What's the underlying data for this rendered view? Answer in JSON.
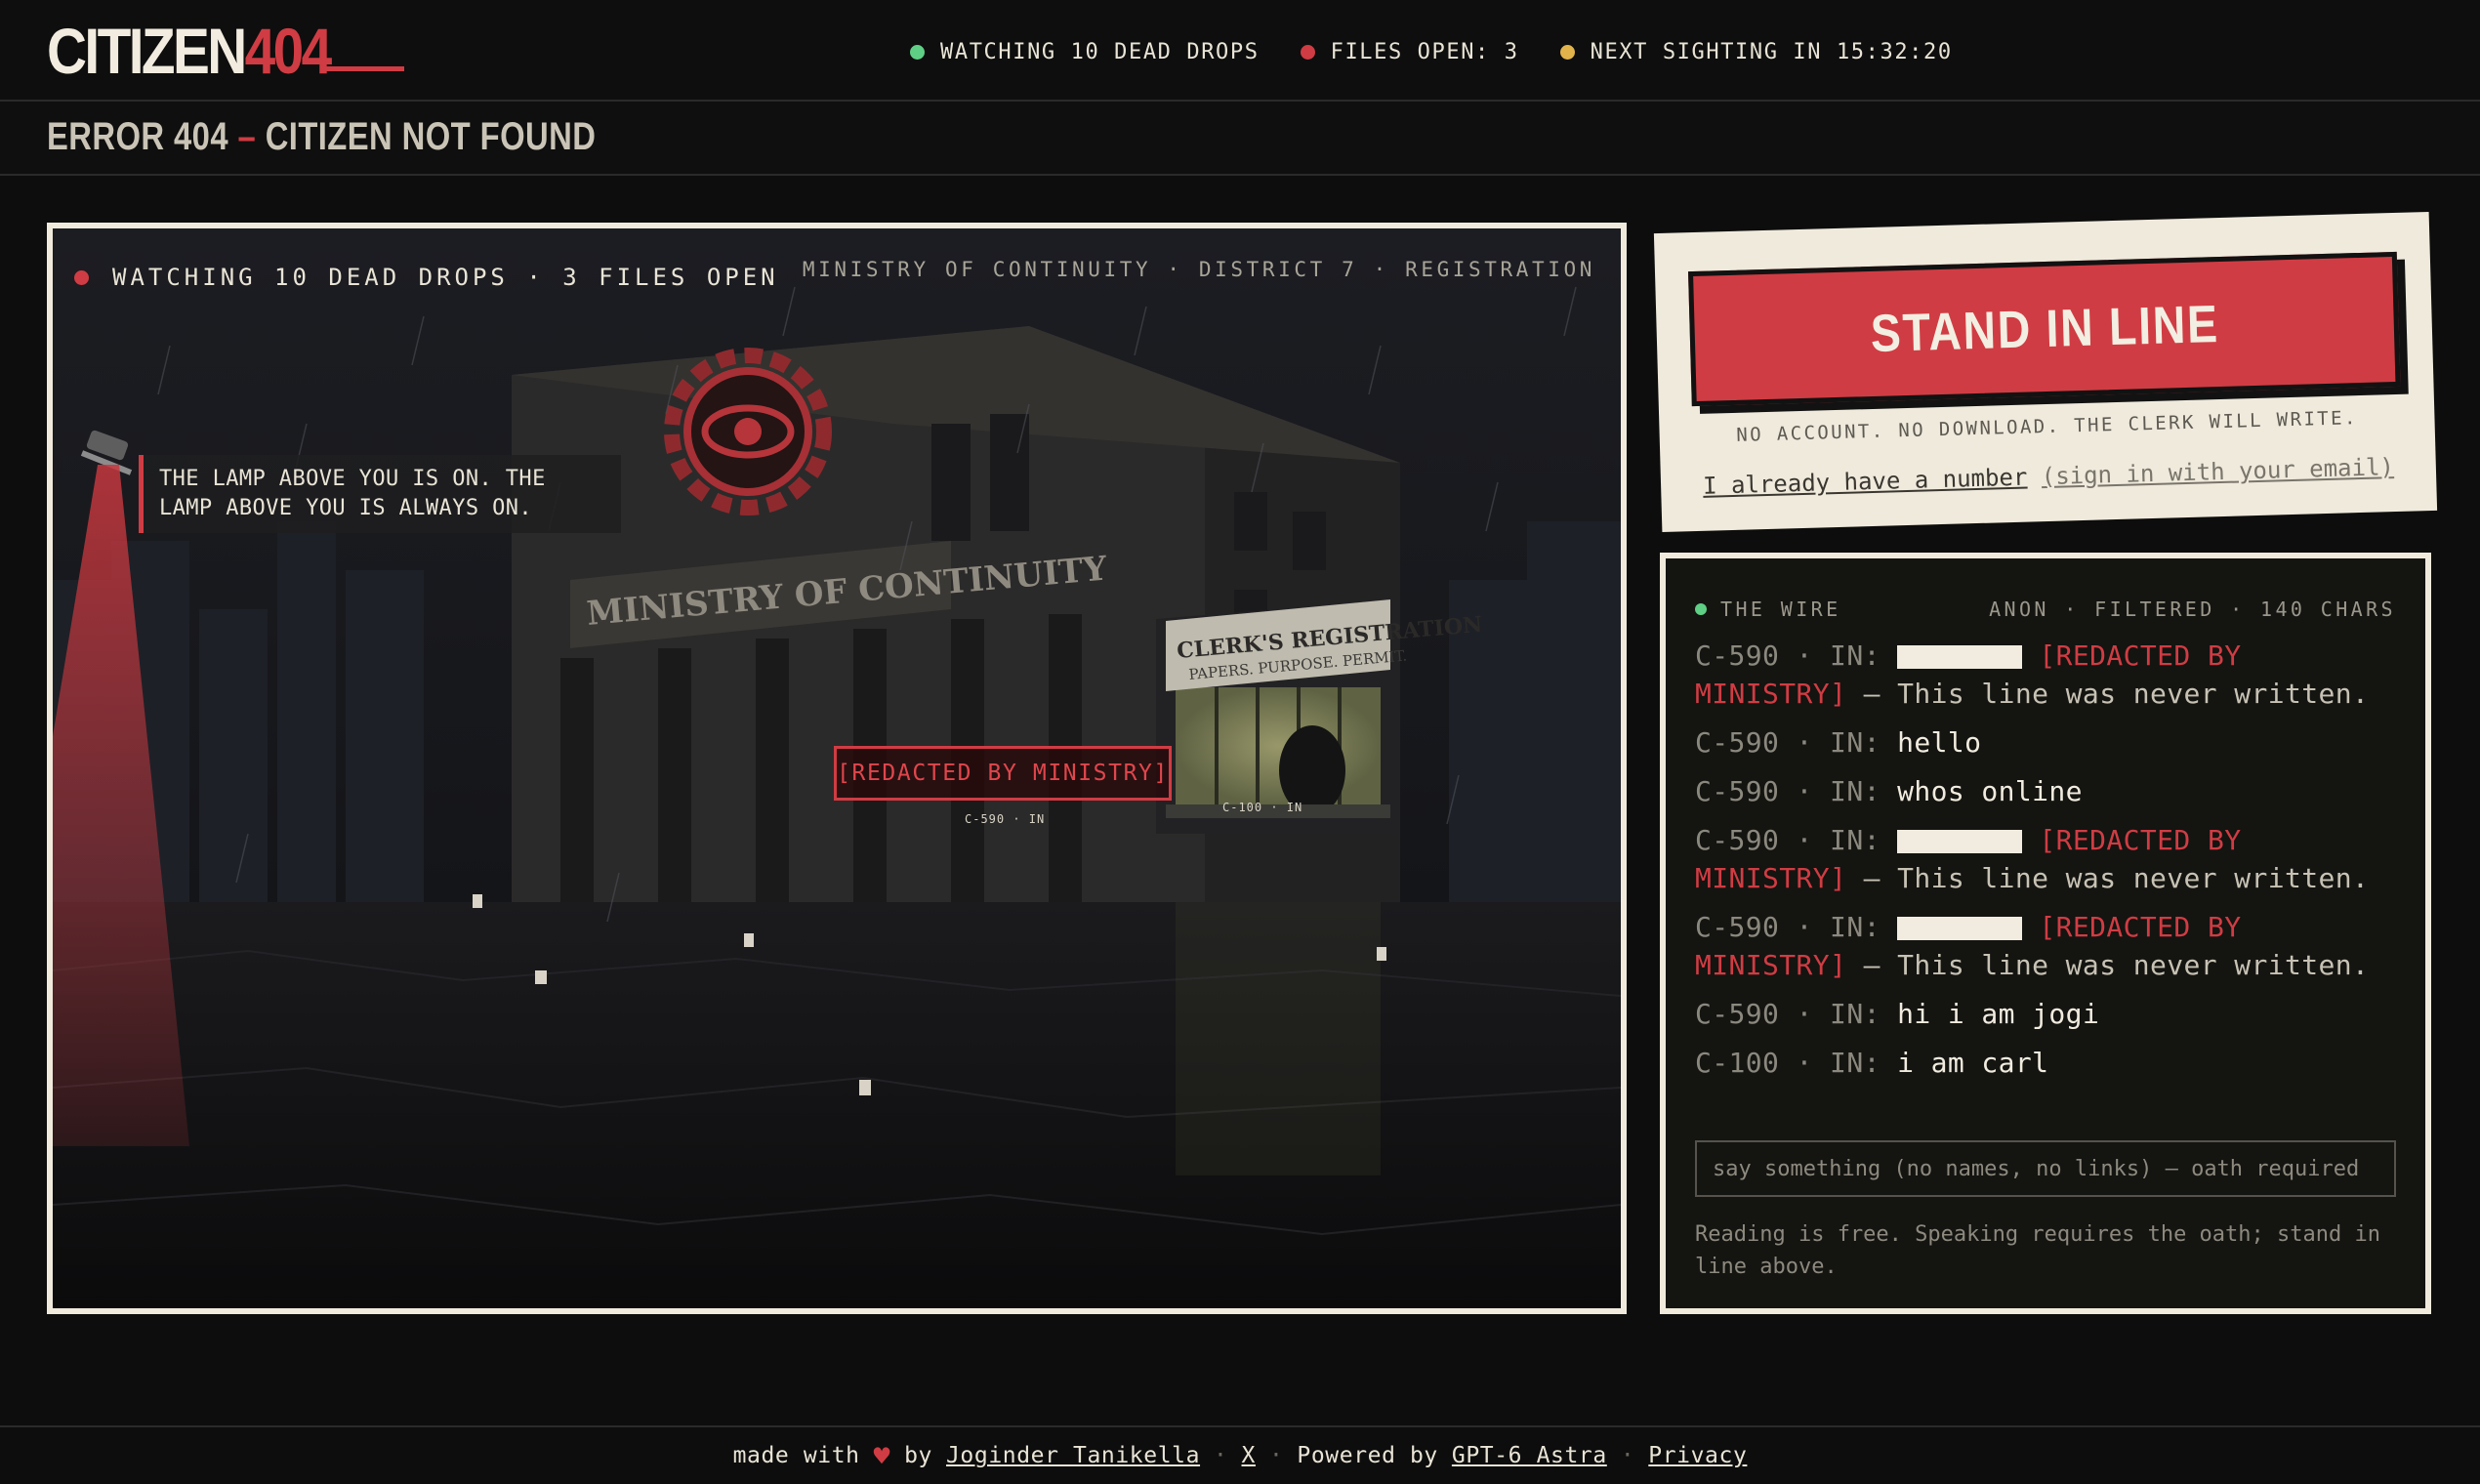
{
  "brand": {
    "word": "CITIZEN",
    "number": "404"
  },
  "status": {
    "items": [
      {
        "label": "WATCHING 10 DEAD DROPS",
        "color": "#5fcf86"
      },
      {
        "label": "FILES OPEN: 3",
        "color": "#d03c43"
      },
      {
        "label": "NEXT SIGHTING IN 15:32:20",
        "color": "#e1b34a"
      }
    ]
  },
  "page": {
    "title_left": "ERROR 404",
    "title_dash": "–",
    "title_right": "CITIZEN NOT FOUND"
  },
  "scene": {
    "status": "WATCHING 10 DEAD DROPS · 3 FILES OPEN",
    "location": "MINISTRY OF CONTINUITY · DISTRICT 7 · REGISTRATION",
    "lamp_caption": "THE LAMP ABOVE YOU IS ON. THE LAMP ABOVE YOU IS ALWAYS ON.",
    "building_sign": "MINISTRY OF CONTINUITY",
    "booth_sign_title": "CLERK'S REGISTRATION",
    "booth_sign_sub": "PAPERS. PURPOSE. PERMIT.",
    "redacted_sign": "[REDACTED BY MINISTRY]",
    "redacted_tag": "C-590 · IN",
    "clerk_tag": "C-100 · IN"
  },
  "cta": {
    "button": "STAND IN LINE",
    "note": "NO ACCOUNT. NO DOWNLOAD. THE CLERK WILL WRITE.",
    "link_main": "I already have a number",
    "link_sub": "(sign in with your email)"
  },
  "wire": {
    "title": "THE WIRE",
    "meta": "ANON · FILTERED · 140 CHARS",
    "messages": [
      {
        "who": "C-590 · IN:",
        "redacted": true,
        "red": "[REDACTED BY MINISTRY]",
        "tail": " — This line was never written."
      },
      {
        "who": "C-590 · IN:",
        "text": "hello"
      },
      {
        "who": "C-590 · IN:",
        "text": "whos online"
      },
      {
        "who": "C-590 · IN:",
        "redacted": true,
        "red": "[REDACTED BY MINISTRY]",
        "tail": " — This line was never written."
      },
      {
        "who": "C-590 · IN:",
        "redacted": true,
        "red": "[REDACTED BY MINISTRY]",
        "tail": " — This line was never written."
      },
      {
        "who": "C-590 · IN:",
        "text": "hi i am jogi"
      },
      {
        "who": "C-100 · IN:",
        "text": "i am carl"
      }
    ],
    "input_placeholder": "say something (no names, no links) — oath required",
    "footnote": "Reading is free. Speaking requires the oath; stand in line above."
  },
  "footer": {
    "made_with": "made with",
    "by": "by",
    "author": "Joginder Tanikella",
    "sep": "·",
    "x": "X",
    "powered": "Powered by",
    "engine": "GPT-6 Astra",
    "privacy": "Privacy"
  }
}
